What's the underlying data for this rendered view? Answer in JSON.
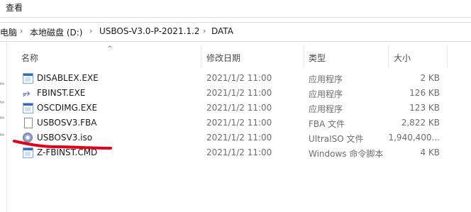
{
  "ribbon": {
    "view_label": "查看"
  },
  "breadcrumb": {
    "items": [
      "电脑",
      "本地磁盘 (D:)",
      "USBOS-V3.0-P-2021.1.2",
      "DATA"
    ]
  },
  "columns": {
    "name": "名称",
    "modified": "修改日期",
    "type": "类型",
    "size": "大小"
  },
  "files": [
    {
      "name": "DISABLEX.EXE",
      "modified": "2021/1/2 11:00",
      "type": "应用程序",
      "size": "2 KB",
      "icon": "exe-icon"
    },
    {
      "name": "FBINST.EXE",
      "modified": "2021/1/2 11:00",
      "type": "应用程序",
      "size": "126 KB",
      "icon": "usb-icon"
    },
    {
      "name": "OSCDIMG.EXE",
      "modified": "2021/1/2 11:00",
      "type": "应用程序",
      "size": "123 KB",
      "icon": "exe-icon"
    },
    {
      "name": "USBOSV3.FBA",
      "modified": "2021/1/2 11:00",
      "type": "FBA 文件",
      "size": "2,822 KB",
      "icon": "file-icon"
    },
    {
      "name": "USBOSV3.iso",
      "modified": "2021/1/2 11:00",
      "type": "UltraISO 文件",
      "size": "1,940,400...",
      "icon": "disc-icon"
    },
    {
      "name": "Z-FBINST.CMD",
      "modified": "2021/1/2 11:00",
      "type": "Windows 命令脚本",
      "size": "4 KB",
      "icon": "cmd-icon"
    }
  ],
  "annotation": {
    "color": "#e3001b"
  }
}
